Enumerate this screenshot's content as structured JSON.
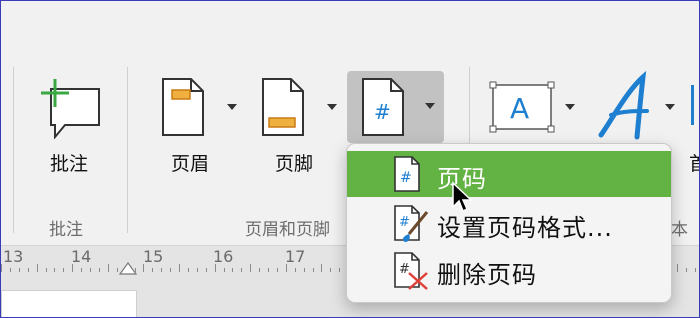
{
  "ribbon": {
    "comment": {
      "label": "批注",
      "group": "批注"
    },
    "header": {
      "label": "页眉"
    },
    "footer": {
      "label": "页脚"
    },
    "header_footer_group": "页眉和页脚",
    "text_group_partial": "本",
    "partial_tool": "首"
  },
  "ruler": {
    "numbers": [
      "13",
      "14",
      "15",
      "16",
      "17"
    ]
  },
  "menu": {
    "items": [
      {
        "label": "页码"
      },
      {
        "label": "设置页码格式..."
      },
      {
        "label": "删除页码"
      }
    ]
  },
  "colors": {
    "accent_green": "#63b244",
    "orange": "#f0a030",
    "blue": "#1e7fd0",
    "red": "#e0403a"
  }
}
